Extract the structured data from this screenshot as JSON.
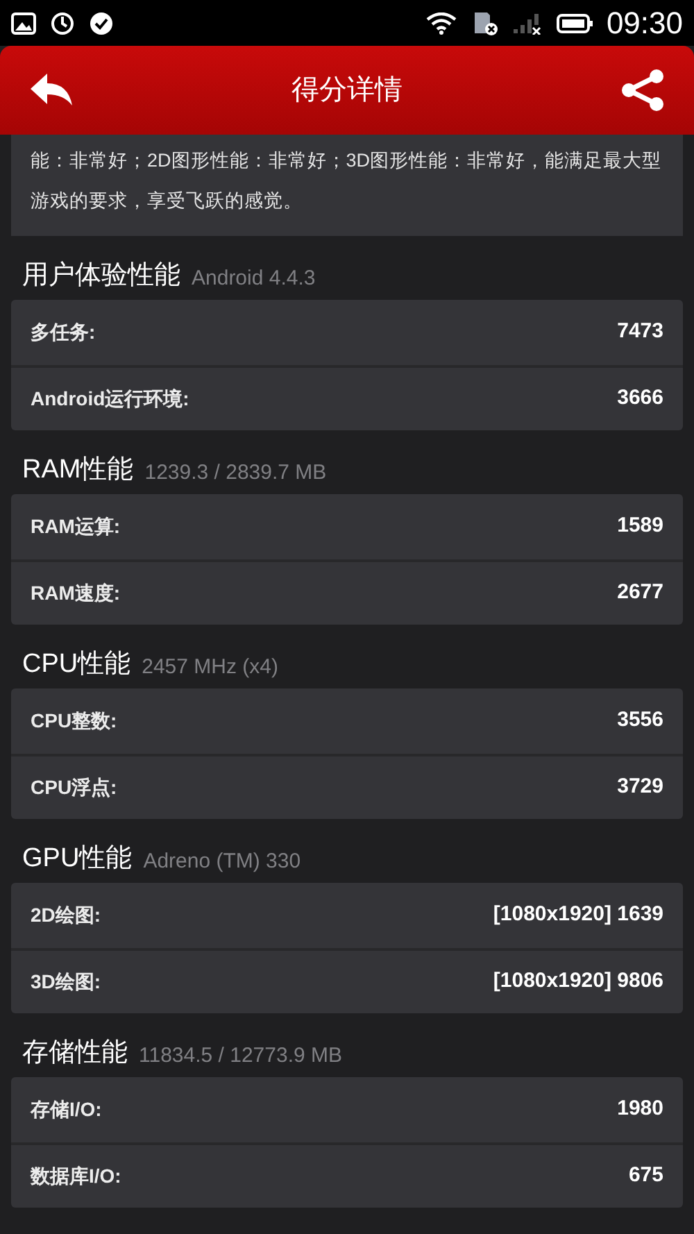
{
  "status_bar": {
    "time": "09:30"
  },
  "header": {
    "title": "得分详情"
  },
  "description": {
    "text": "能：非常好；2D图形性能：非常好；3D图形性能：非常好，能满足最大型游戏的要求，享受飞跃的感觉。"
  },
  "sections": [
    {
      "title": "用户体验性能",
      "subtitle": "Android 4.4.3",
      "rows": [
        {
          "label": "多任务:",
          "value": "7473"
        },
        {
          "label": "Android运行环境:",
          "value": "3666"
        }
      ]
    },
    {
      "title": "RAM性能",
      "subtitle": "1239.3 / 2839.7 MB",
      "rows": [
        {
          "label": "RAM运算:",
          "value": "1589"
        },
        {
          "label": "RAM速度:",
          "value": "2677"
        }
      ]
    },
    {
      "title": "CPU性能",
      "subtitle": "2457 MHz (x4)",
      "rows": [
        {
          "label": "CPU整数:",
          "value": "3556"
        },
        {
          "label": "CPU浮点:",
          "value": "3729"
        }
      ]
    },
    {
      "title": "GPU性能",
      "subtitle": "Adreno (TM) 330",
      "rows": [
        {
          "label": "2D绘图:",
          "value": "[1080x1920] 1639"
        },
        {
          "label": "3D绘图:",
          "value": "[1080x1920] 9806"
        }
      ]
    },
    {
      "title": "存储性能",
      "subtitle": "11834.5 / 12773.9 MB",
      "rows": [
        {
          "label": "存储I/O:",
          "value": "1980"
        },
        {
          "label": "数据库I/O:",
          "value": "675"
        }
      ]
    }
  ]
}
